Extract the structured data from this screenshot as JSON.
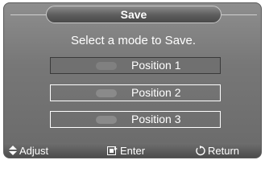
{
  "dialog": {
    "title": "Save",
    "prompt": "Select a mode to Save."
  },
  "options": [
    {
      "label": "Position 1",
      "selected": true
    },
    {
      "label": "Position 2",
      "selected": false
    },
    {
      "label": "Position 3",
      "selected": false
    }
  ],
  "footer": {
    "adjust_label": "Adjust",
    "adjust_icon": "up-down-arrows-icon",
    "enter_label": "Enter",
    "enter_icon": "enter-icon",
    "return_label": "Return",
    "return_icon": "return-arrow-icon"
  },
  "colors": {
    "panel": "#777777",
    "selected_row": "#707070",
    "text": "#ffffff"
  }
}
